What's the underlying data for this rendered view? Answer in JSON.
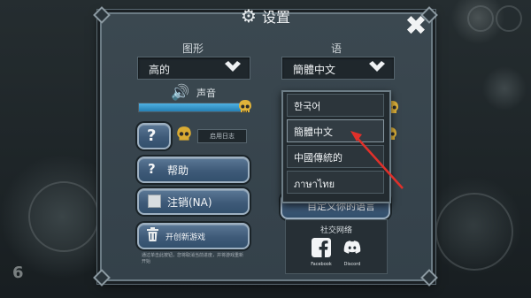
{
  "dialog": {
    "title": "设置",
    "close_label": "✖"
  },
  "graphics": {
    "label": "图形",
    "quality_value": "高的"
  },
  "language": {
    "label": "语",
    "current_value": "簡體中文",
    "options": [
      "한국어",
      "簡體中文",
      "中國傳統的",
      "ภาษาไทย"
    ]
  },
  "sound": {
    "label": "声音",
    "level": 0.98
  },
  "log": {
    "question_label": "?",
    "enable_log_label": "启用日志"
  },
  "buttons": {
    "help_icon": "?",
    "help_label": "帮助",
    "logout_label": "注销(NA)",
    "new_game_label": "开创新游戏",
    "feedback_label": "自定义你的语言"
  },
  "footnote": "通过单击此按钮，您将取消当前进度，并将游戏重新开始",
  "social": {
    "title": "社交网络",
    "facebook_label": "Facebook",
    "discord_label": "Discord"
  },
  "colors": {
    "slider_fill": "#3b9bd0",
    "button_blue": "#3e5a78",
    "skull": "#e0b33a",
    "arrow": "#e0302a",
    "facebook": "#f2f4f6",
    "discord": "#f2f4f6"
  },
  "icons": {
    "settings": "gear-icon",
    "close": "close-icon",
    "dropdown": "chevron-down-icon",
    "sound": "speaker-icon",
    "skull": "skull-icon",
    "trash": "trash-icon",
    "facebook": "facebook-icon",
    "discord": "discord-icon"
  }
}
